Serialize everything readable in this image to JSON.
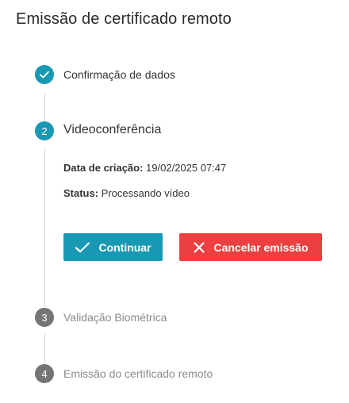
{
  "page": {
    "title": "Emissão de certificado remoto"
  },
  "steps": [
    {
      "number": "1",
      "label": "Confirmação de dados",
      "state": "done"
    },
    {
      "number": "2",
      "label": "Videoconferência",
      "state": "active"
    },
    {
      "number": "3",
      "label": "Validação Biométrica",
      "state": "pending"
    },
    {
      "number": "4",
      "label": "Emissão do certificado remoto",
      "state": "pending"
    }
  ],
  "details": {
    "created_label": "Data de criação:",
    "created_value": " 19/02/2025 07:47",
    "status_label": "Status:",
    "status_value": " Processando vídeo"
  },
  "actions": {
    "continue_label": "Continuar",
    "cancel_label": "Cancelar emissão"
  },
  "colors": {
    "accent": "#1998b4",
    "danger": "#ec4040",
    "pending": "#757575"
  }
}
